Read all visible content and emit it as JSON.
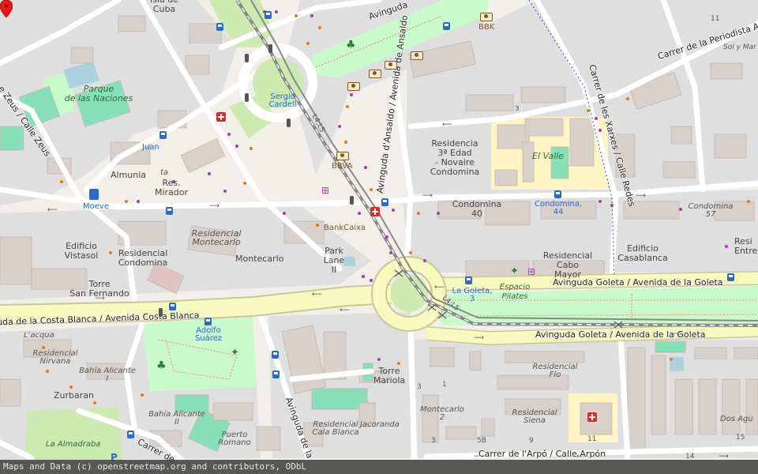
{
  "map": {
    "attribution": "Maps and Data (c) openstreetmap.org and contributors, ODbL",
    "colors": {
      "land": "#f2efe9",
      "residential": "#e0dfdf",
      "building": "#d9d0c9",
      "park": "#c8facc",
      "grass": "#cdebb0",
      "major_road": "#f7fabf",
      "road": "#ffffff",
      "rail": "#777777",
      "marker": "#e41a1c",
      "school": "#fff4c4",
      "water": "#aad3df"
    },
    "icons": [
      "bus-stop-icon",
      "bank-icon",
      "pharmacy-icon",
      "traffic-signal-icon",
      "location-marker-icon",
      "playground-icon",
      "fitness-icon",
      "shop-icon",
      "parking-icon",
      "hospital-icon"
    ]
  },
  "streets": {
    "avinguda_top": "Avinguda",
    "ansaldo": "Avinguda d'Ansaldo / Avenida de Ansaldo",
    "periodista": "Carrer de la Periodista Asun",
    "xarxes": "Carrer de les Xarxes / Calle Redes",
    "zeus": "e Zeus / Calle Zeus",
    "goleta_upper": "Avinguda Goleta / Avenida de la Goleta",
    "goleta_lower": "Avinguda Goleta / Avenida de la Goleta",
    "costa_blanca": "uda de la Costa Blanca / Avenida Costa Blanca",
    "avinguda_bottom": "Avinguda de la",
    "arpo": "Carrer de l'Arpó / Calle Arpón",
    "carrer_de": "Carrer de",
    "line_l4": "L4;L5",
    "line_l5": "L4;L5"
  },
  "labels": {
    "isla_cuba": "Isla de\nCuba",
    "parque_naciones": "Parque\nde las Naciones",
    "sergio_cardell": "Sergio\nCardell",
    "juan": "Juan",
    "almunia": "Almunia",
    "ta": "ta",
    "res_mirador": "Res.\nMirador",
    "moeve": "Moeve",
    "bbk": "BBK",
    "bbva": "BBVA",
    "residencia": "Residencia\n3ª Edad\n- Novaire\nCondomina",
    "el_valle": "El Valle",
    "condomina40": "Condomina\n40",
    "condomina44": "Condomina,\n44",
    "condomina57": "Condomina\n57",
    "resi_entrep": "Resi\nEntrep",
    "bankcaixa": "BankCaixa",
    "edificio_vistasol": "Edificio\nVistasol",
    "residencial_condomina": "Residencial\nCondomina",
    "residencial_montecarlo": "Residencial\nMontecarlo",
    "montecarlo": "Montecarlo",
    "park_lane": "Park\nLane\nII",
    "edificio_casablanca": "Edificio\nCasablanca",
    "residencial_cabo": "Residencial\nCabo\nMayor",
    "torre_san_fernando": "Torre\nSan Fernando",
    "la_goleta3": "La Goleta,\n3",
    "espacio_pilates": "Espacio\nPilates",
    "adolfo_suarez": "Adolfo\nSuárez",
    "lacqua": "L'acqua",
    "residencial_nirvana": "Residencial\nNirvana",
    "bahia_alicante": "Bahía Alicante\nI",
    "zurbaran": "Zurbaran",
    "bahia_alicante2": "Bahía Alicante\nII",
    "la_almadraba": "La Almadraba",
    "torre_mariola": "Torre\nMariola",
    "residencial_cala_blanca": "Residencial\nCala Blanca",
    "jacoranda": "Jacoranda",
    "puerto_romano": "Puerto\nRomano",
    "montecarlo2": "Montecarlo\n2",
    "residencial_flo": "Residencial\nFlo",
    "residencial_siena": "Residencial\nSiena",
    "dos_agu": "Dos Agu",
    "sol_y_mar": "Sol y Mar"
  },
  "numbers": {
    "n11_top": "11",
    "n3_mid": "3",
    "n3_a": "3",
    "n1": "1",
    "n3_b": "3",
    "n5b": "5B",
    "n9": "9",
    "n11_b": "11",
    "n15": "15",
    "n14": "14"
  }
}
